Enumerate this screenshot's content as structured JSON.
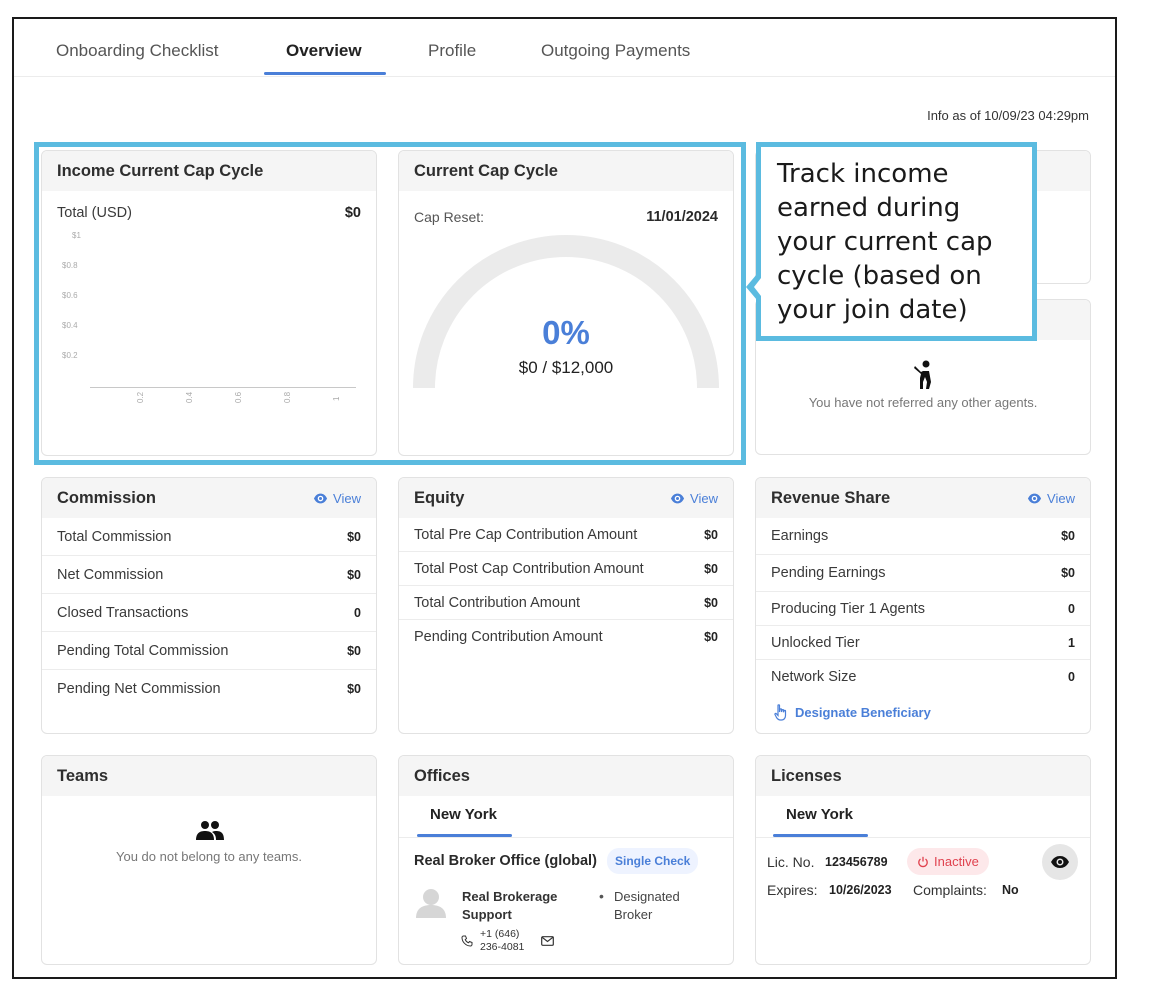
{
  "tabs": [
    {
      "label": "Onboarding Checklist"
    },
    {
      "label": "Overview"
    },
    {
      "label": "Profile"
    },
    {
      "label": "Outgoing Payments"
    }
  ],
  "info_asof": "Info as of 10/09/23 04:29pm",
  "income": {
    "title": "Income Current Cap Cycle",
    "total_label": "Total (USD)",
    "total_value": "$0"
  },
  "chart_data": {
    "type": "line",
    "title": "",
    "xlabel": "",
    "ylabel": "",
    "y_ticks": [
      "$1",
      "$0.8",
      "$0.6",
      "$0.4",
      "$0.2"
    ],
    "x_ticks": [
      "0.2",
      "0.4",
      "0.6",
      "0.8",
      "1"
    ],
    "series": [],
    "xlim": [
      0,
      1
    ],
    "ylim": [
      0,
      1
    ],
    "grid": false
  },
  "cap": {
    "title": "Current Cap Cycle",
    "reset_label": "Cap Reset:",
    "reset_date": "11/01/2024",
    "percent": "0%",
    "percent_value": 0,
    "amount": "$0 / $12,000"
  },
  "callout": {
    "text": "Track income earned during your current cap cycle (based on your join date)"
  },
  "referrals": {
    "empty": "You have not referred any other agents."
  },
  "commission": {
    "title": "Commission",
    "view": "View",
    "rows": [
      {
        "label": "Total Commission",
        "value": "$0"
      },
      {
        "label": "Net Commission",
        "value": "$0"
      },
      {
        "label": "Closed Transactions",
        "value": "0"
      },
      {
        "label": "Pending Total Commission",
        "value": "$0"
      },
      {
        "label": "Pending Net Commission",
        "value": "$0"
      }
    ]
  },
  "equity": {
    "title": "Equity",
    "view": "View",
    "rows": [
      {
        "label": "Total Pre Cap Contribution Amount",
        "value": "$0"
      },
      {
        "label": "Total Post Cap Contribution Amount",
        "value": "$0"
      },
      {
        "label": "Total Contribution Amount",
        "value": "$0"
      },
      {
        "label": "Pending Contribution Amount",
        "value": "$0"
      }
    ]
  },
  "revenue": {
    "title": "Revenue Share",
    "view": "View",
    "rows": [
      {
        "label": "Earnings",
        "value": "$0"
      },
      {
        "label": "Pending Earnings",
        "value": "$0"
      },
      {
        "label": "Producing Tier 1 Agents",
        "value": "0"
      },
      {
        "label": "Unlocked Tier",
        "value": "1"
      },
      {
        "label": "Network Size",
        "value": "0"
      }
    ],
    "designate": "Designate Beneficiary"
  },
  "teams": {
    "title": "Teams",
    "empty": "You do not belong to any teams."
  },
  "offices": {
    "title": "Offices",
    "tab": "New York",
    "office_name": "Real Broker Office (global)",
    "badge": "Single Check",
    "contact_name": "Real Brokerage Support",
    "contact_role": "Designated Broker",
    "phone": "+1 (646) 236-4081"
  },
  "licenses": {
    "title": "Licenses",
    "tab": "New York",
    "lic_label": "Lic. No.",
    "lic_no": "123456789",
    "status": "Inactive",
    "expires_label": "Expires:",
    "expires": "10/26/2023",
    "complaints_label": "Complaints:",
    "complaints": "No"
  },
  "colors": {
    "accent": "#4a7fd8",
    "highlight": "#5bbbe0",
    "inactive": "#e0424f"
  }
}
